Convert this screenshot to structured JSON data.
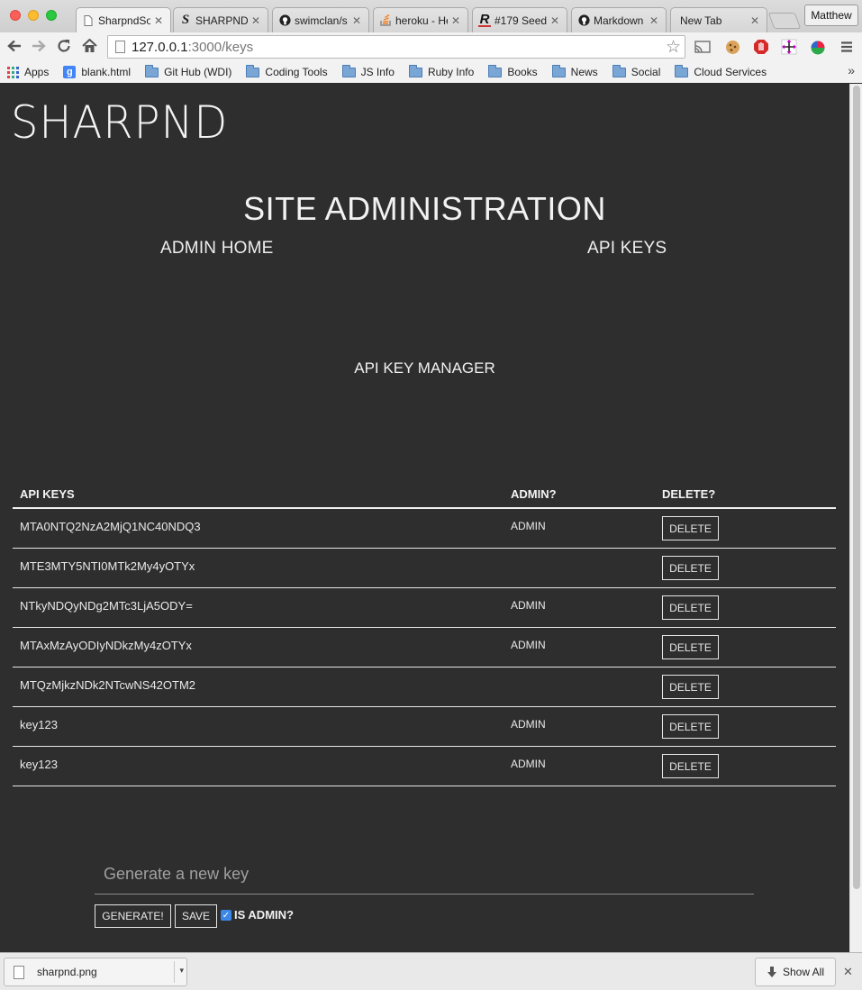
{
  "browser": {
    "tabs": [
      {
        "title": "SharpndSo",
        "icon": "page-icon",
        "active": true
      },
      {
        "title": "SHARPND",
        "icon": "s-logo-icon",
        "active": false
      },
      {
        "title": "swimclan/s",
        "icon": "github-icon",
        "active": false
      },
      {
        "title": "heroku - He",
        "icon": "stackoverflow-icon",
        "active": false
      },
      {
        "title": "#179 Seed",
        "icon": "railscasts-icon",
        "active": false
      },
      {
        "title": "Markdown",
        "icon": "github-icon",
        "active": false
      },
      {
        "title": "New Tab",
        "icon": "",
        "active": false
      }
    ],
    "user": "Matthew",
    "url_host": "127.0.0.1",
    "url_path": ":3000/keys",
    "bookmarks": [
      {
        "label": "Apps",
        "icon": "apps-icon"
      },
      {
        "label": "blank.html",
        "icon": "google-icon"
      },
      {
        "label": "Git Hub (WDI)",
        "icon": "folder-icon"
      },
      {
        "label": "Coding Tools",
        "icon": "folder-icon"
      },
      {
        "label": "JS Info",
        "icon": "folder-icon"
      },
      {
        "label": "Ruby Info",
        "icon": "folder-icon"
      },
      {
        "label": "Books",
        "icon": "folder-icon"
      },
      {
        "label": "News",
        "icon": "folder-icon"
      },
      {
        "label": "Social",
        "icon": "folder-icon"
      },
      {
        "label": "Cloud Services",
        "icon": "folder-icon"
      }
    ],
    "bookmarks_more": "»"
  },
  "page": {
    "logo": "SHARPND",
    "heading": "SITE ADMINISTRATION",
    "nav": {
      "admin_home": "ADMIN HOME",
      "api_keys": "API KEYS"
    },
    "section_title": "API KEY MANAGER",
    "table": {
      "headers": {
        "key": "API KEYS",
        "admin": "ADMIN?",
        "delete": "DELETE?"
      },
      "rows": [
        {
          "key": "MTA0NTQ2NzA2MjQ1NC40NDQ3",
          "admin": "ADMIN",
          "delete": "DELETE"
        },
        {
          "key": "MTE3MTY5NTI0MTk2My4yOTYx",
          "admin": "",
          "delete": "DELETE"
        },
        {
          "key": "NTkyNDQyNDg2MTc3LjA5ODY=",
          "admin": "ADMIN",
          "delete": "DELETE"
        },
        {
          "key": "MTAxMzAyODIyNDkzMy4zOTYx",
          "admin": "ADMIN",
          "delete": "DELETE"
        },
        {
          "key": "MTQzMjkzNDk2NTcwNS42OTM2",
          "admin": "",
          "delete": "DELETE"
        },
        {
          "key": "key123",
          "admin": "ADMIN",
          "delete": "DELETE"
        },
        {
          "key": "key123",
          "admin": "ADMIN",
          "delete": "DELETE"
        }
      ]
    },
    "generator": {
      "placeholder": "Generate a new key",
      "value": "",
      "generate_label": "GENERATE!",
      "save_label": "SAVE",
      "is_admin_label": "IS ADMIN?",
      "is_admin_checked": true
    }
  },
  "downloads": {
    "file": "sharpnd.png",
    "show_all": "Show All"
  },
  "colors": {
    "page_bg": "#2e2e2e",
    "text": "#f2f2f2",
    "checkbox": "#3b88e8"
  }
}
